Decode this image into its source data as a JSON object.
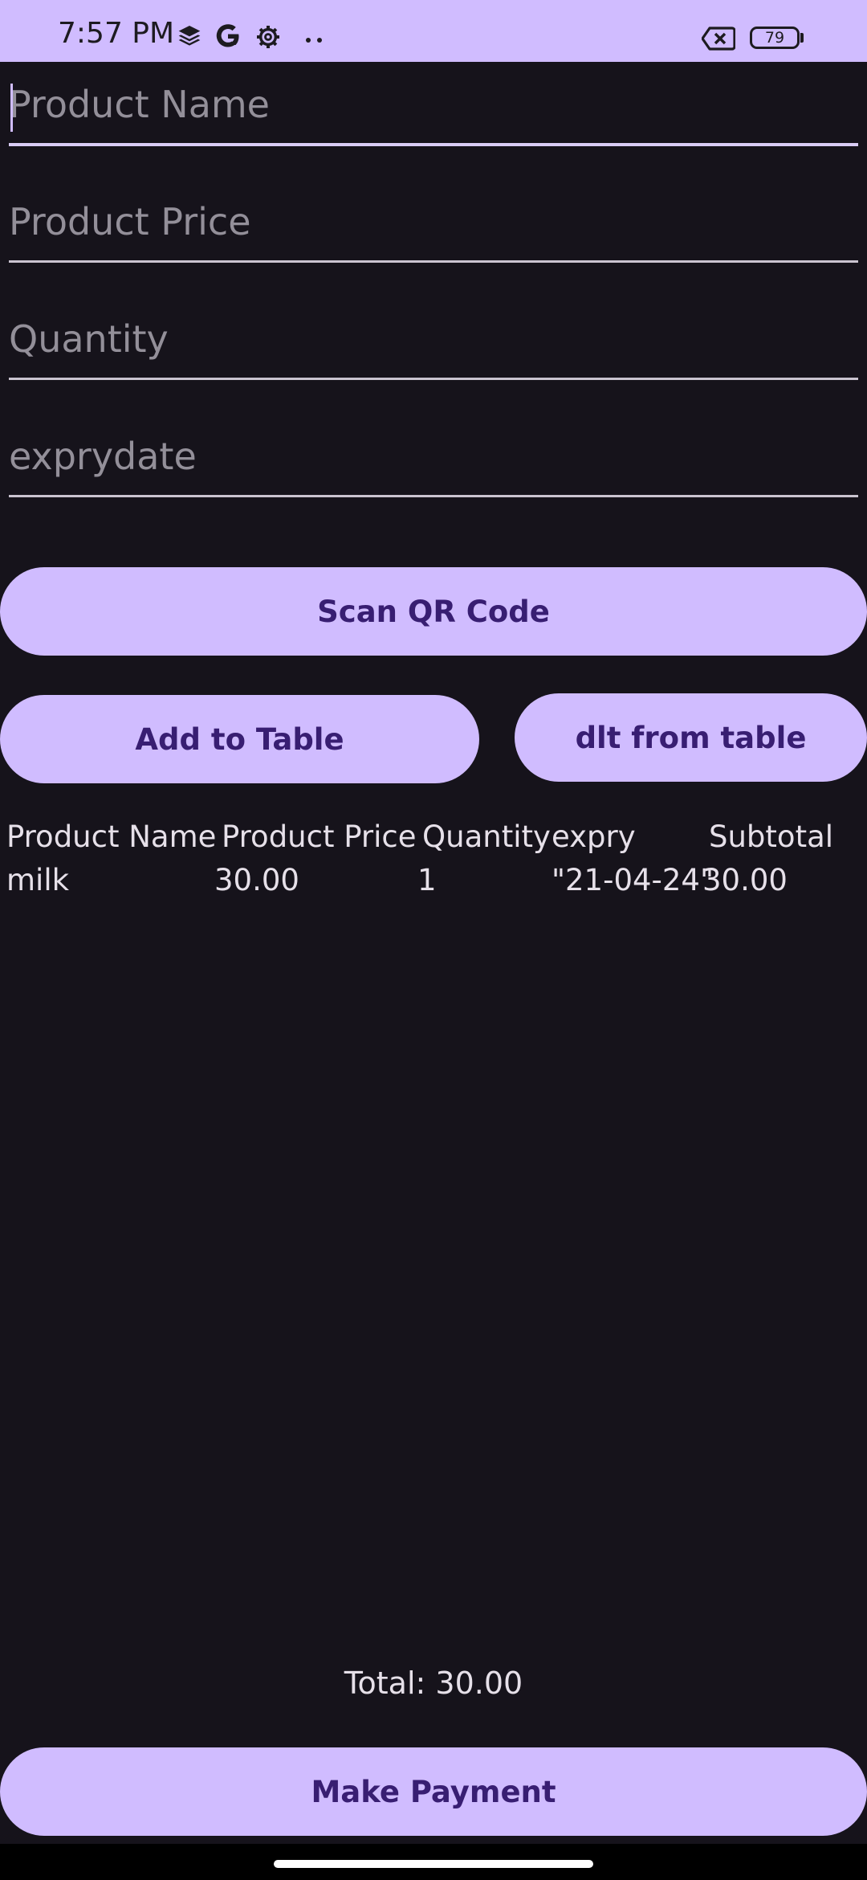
{
  "status_bar": {
    "time": "7:57 PM",
    "battery_level": "79",
    "icons": [
      "layers-icon",
      "google-icon",
      "settings-icon",
      "more-dots-icon",
      "no-sim-icon",
      "battery-icon"
    ]
  },
  "form": {
    "product_name_placeholder": "Product Name",
    "product_price_placeholder": "Product Price",
    "quantity_placeholder": "Quantity",
    "expiry_placeholder": "exprydate"
  },
  "buttons": {
    "scan_qr": "Scan QR Code",
    "add_to_table": "Add to Table",
    "delete_from_table": "dlt from table",
    "make_payment": "Make Payment"
  },
  "table": {
    "headers": [
      "Product Name",
      "Product Price",
      "Quantity",
      "expry",
      "Subtotal"
    ],
    "rows": [
      [
        "milk",
        "30.00",
        "1",
        "\"21-04-24\"",
        "30.00"
      ]
    ]
  },
  "total_text": "Total: 30.00",
  "colors": {
    "background": "#16131b",
    "accent": "#d0bcff",
    "on_accent": "#381e72",
    "text": "#e6e0e9",
    "placeholder": "#938f99"
  }
}
